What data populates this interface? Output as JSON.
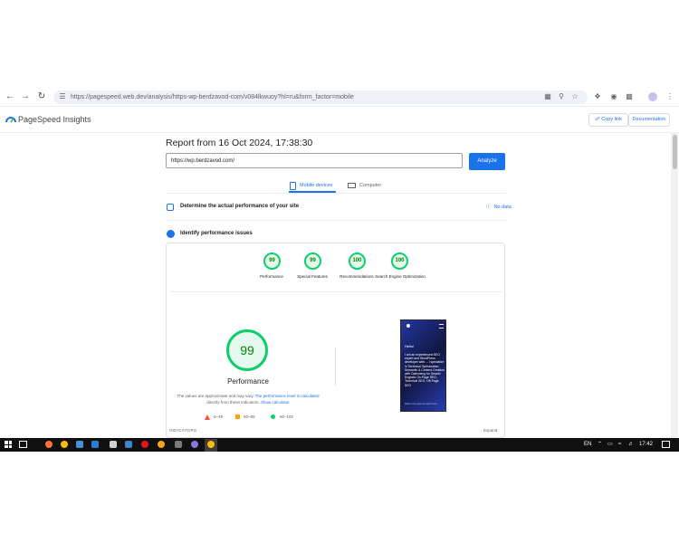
{
  "browser": {
    "url": "https://pagespeed.web.dev/analysis/https-wp-berdzavod-com/v084lkwuoy?hl=ru&form_factor=mobile"
  },
  "header": {
    "brand": "PageSpeed Insights",
    "copy_link": "Copy link",
    "documentation": "Documentation"
  },
  "report": {
    "title": "Report from 16 Oct 2024, 17:38:30",
    "url_value": "https://wp.berdzavod.com/",
    "analyze": "Analyze",
    "tabs": [
      {
        "label": "Mobile devices",
        "selected": true
      },
      {
        "label": "Computer",
        "selected": false
      }
    ],
    "section_real": {
      "label": "Determine the actual performance of your site",
      "status": "No data"
    },
    "section_issues": {
      "label": "Identify performance issues"
    }
  },
  "scores": [
    {
      "value": "99",
      "label": "Performance"
    },
    {
      "value": "99",
      "label": "Special Features"
    },
    {
      "value": "100",
      "label": "Recommendations"
    },
    {
      "value": "100",
      "label": "Search Engine Optimization"
    }
  ],
  "performance": {
    "score": "99",
    "title": "Performance",
    "note_start": "The values are approximate and may vary.",
    "note_link1": "The performance level is calculated",
    "note_mid": "directly from these indicators.",
    "note_link2": "Show calculator",
    "legend": [
      {
        "range": "0–49",
        "color": "#ff4e42"
      },
      {
        "range": "50–89",
        "color": "#ffa400"
      },
      {
        "range": "90–100",
        "color": "#0cce6b"
      }
    ]
  },
  "preview": {
    "hello": "Hello!",
    "body": "I am an experienced SEO expert and WordPress developer with ... I specialize in Technical Optimization, Semantic & Content Creation with Optimizing for Search Engines On-Page SEO, Technical SEO, Off-Page SEO",
    "more": "More info and contact here"
  },
  "footer": {
    "indicators": "INDICATORS",
    "expand": "Expand"
  },
  "taskbar": {
    "lang": "EN",
    "time": "17:42"
  },
  "colors": {
    "accent": "#1a73e8",
    "pass": "#0cce6b"
  }
}
